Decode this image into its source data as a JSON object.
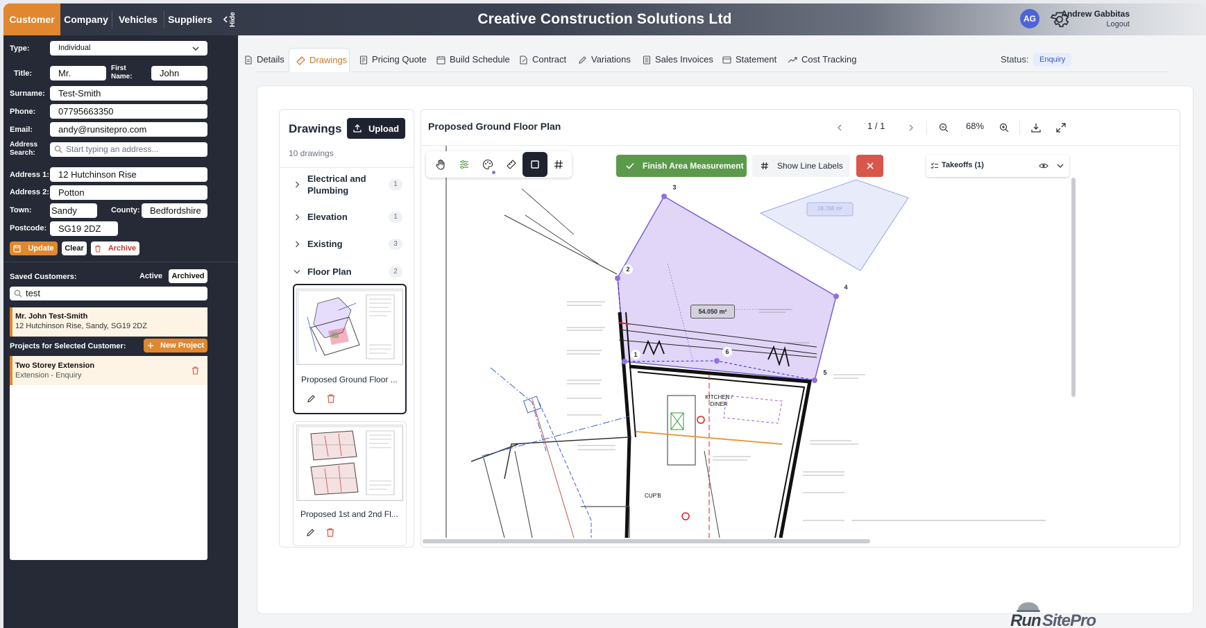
{
  "top_tabs": [
    "Customer",
    "Company",
    "Vehicles",
    "Suppliers"
  ],
  "hide_label": "Hide",
  "brand": "Creative Construction Solutions Ltd",
  "user": {
    "name": "Andrew Gabbitas",
    "logout": "Logout",
    "initials": "AG"
  },
  "form": {
    "type_label": "Type:",
    "type_value": "Individual",
    "title_label": "Title:",
    "title_value": "Mr.",
    "first_name_label": "First Name:",
    "first_name_value": "John",
    "surname_label": "Surname:",
    "surname_value": "Test-Smith",
    "phone_label": "Phone:",
    "phone_value": "07795663350",
    "email_label": "Email:",
    "email_value": "andy@runsitepro.com",
    "address_search_label": "Address Search:",
    "address_search_placeholder": "Start typing an address...",
    "address1_label": "Address 1:",
    "address1_value": "12 Hutchinson Rise",
    "address2_label": "Address 2:",
    "address2_value": "Potton",
    "town_label": "Town:",
    "town_value": "Sandy",
    "county_label": "County:",
    "county_value": "Bedfordshire",
    "postcode_label": "Postcode:",
    "postcode_value": "SG19 2DZ",
    "update": "Update",
    "clear": "Clear",
    "archive": "Archive"
  },
  "saved": {
    "label": "Saved Customers:",
    "active": "Active",
    "archived": "Archived",
    "search": "test",
    "customer_name": "Mr. John Test-Smith",
    "customer_address": "12 Hutchinson Rise, Sandy, SG19 2DZ",
    "projects_label": "Projects for Selected Customer:",
    "new_project": "New Project",
    "project_name": "Two Storey Extension",
    "project_sub": "Extension - Enquiry"
  },
  "page_tabs": [
    {
      "label": "Details",
      "icon": "document-icon"
    },
    {
      "label": "Drawings",
      "icon": "ruler-icon"
    },
    {
      "label": "Pricing Quote",
      "icon": "receipt-icon"
    },
    {
      "label": "Build Schedule",
      "icon": "calendar-icon"
    },
    {
      "label": "Contract",
      "icon": "contract-icon"
    },
    {
      "label": "Variations",
      "icon": "pencil-icon"
    },
    {
      "label": "Sales Invoices",
      "icon": "invoice-icon"
    },
    {
      "label": "Statement",
      "icon": "card-icon"
    },
    {
      "label": "Cost Tracking",
      "icon": "trend-icon"
    }
  ],
  "status": {
    "label": "Status:",
    "value": "Enquiry"
  },
  "drawings_panel": {
    "title": "Drawings",
    "upload": "Upload",
    "count": "10 drawings",
    "categories": [
      {
        "name": "Electrical and Plumbing",
        "count": "1"
      },
      {
        "name": "Elevation",
        "count": "1"
      },
      {
        "name": "Existing",
        "count": "3"
      },
      {
        "name": "Floor Plan",
        "count": "2"
      }
    ],
    "thumbs": [
      {
        "name": "Proposed Ground Floor ..."
      },
      {
        "name": "Proposed 1st and 2nd Fl..."
      }
    ]
  },
  "viewer": {
    "title": "Proposed Ground Floor Plan",
    "page": "1 / 1",
    "zoom": "68%",
    "finish_area": "Finish Area Measurement",
    "show_labels": "Show Line Labels",
    "takeoffs": "Takeoffs (1)",
    "area_main": "54.050 m²",
    "area_ghost": "18.768 m²",
    "points": [
      "1",
      "2",
      "3",
      "4",
      "5",
      "6"
    ],
    "room_label": "KITCHEN / DINER",
    "cupb": "CUP'B"
  },
  "logo": {
    "run": "Run",
    "site": "SitePro"
  },
  "colors": {
    "accent": "#e0872f",
    "dark": "#262a36",
    "green": "#5b9a4a",
    "red": "#d9564a",
    "purple": "#a98ae8",
    "avatar": "#4f63d8"
  }
}
